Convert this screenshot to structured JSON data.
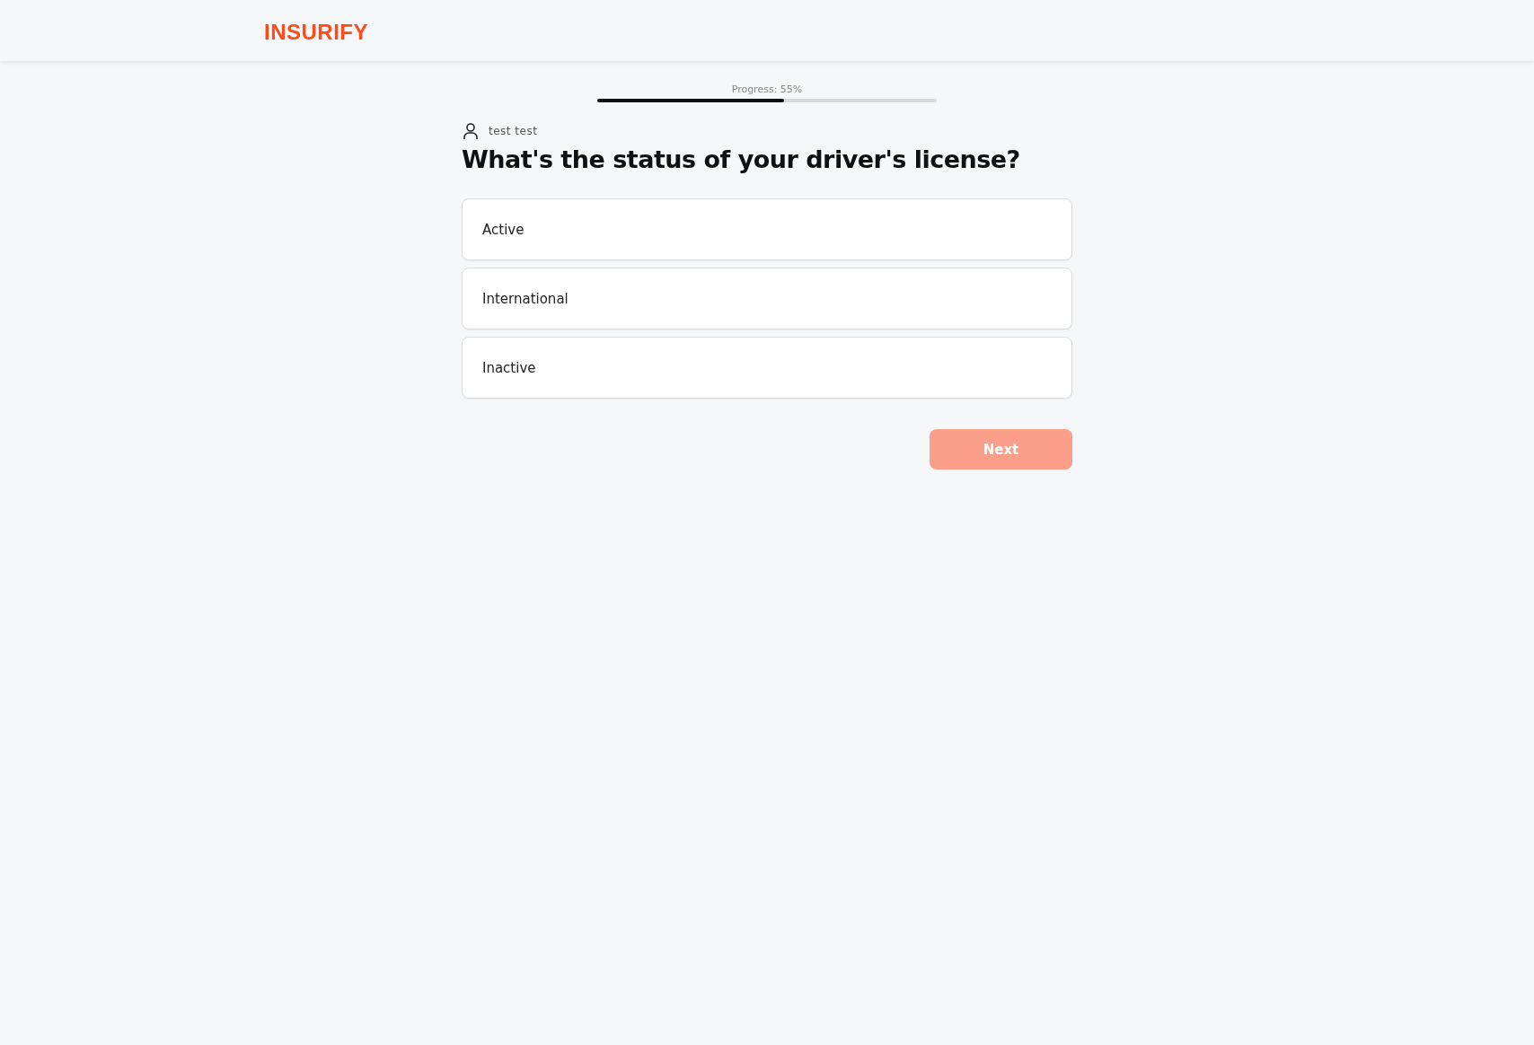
{
  "header": {
    "logo": "INSURIFY"
  },
  "progress": {
    "label": "Progress: 55%",
    "level": 0.55
  },
  "user": {
    "name": "test test"
  },
  "question": "What's the status of your driver's license?",
  "options": [
    {
      "label": "Active",
      "selected": false
    },
    {
      "label": "International",
      "selected": false
    },
    {
      "label": "Inactive",
      "selected": false
    }
  ],
  "next_button": {
    "label": "Next",
    "disabled": true
  }
}
